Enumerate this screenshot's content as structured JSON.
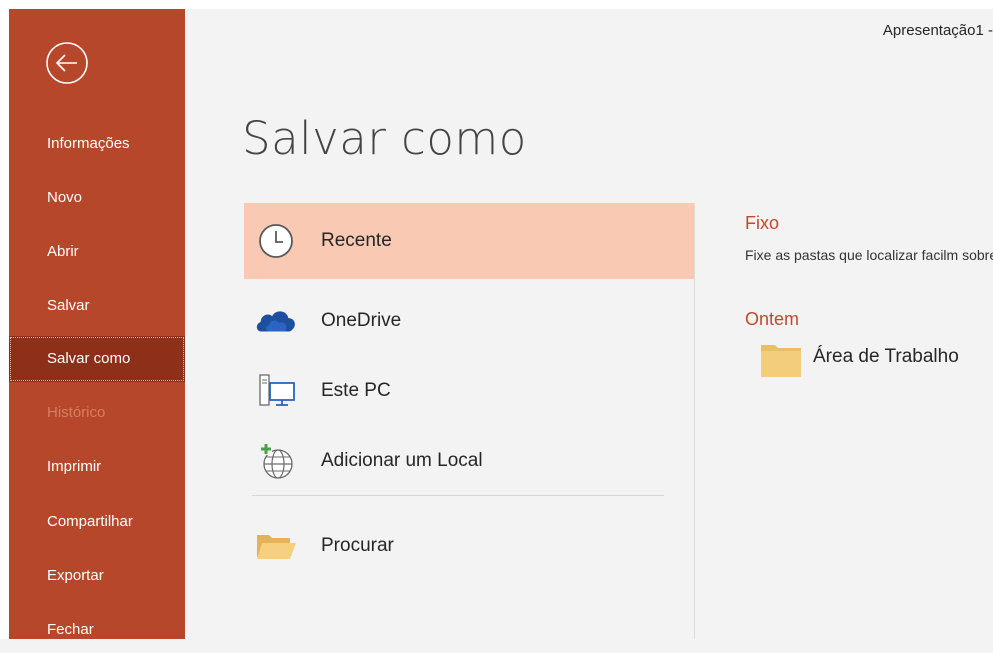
{
  "window": {
    "document_title": "Apresentação1 -"
  },
  "sidebar": {
    "back_icon": "arrow-left-circle-icon",
    "items": [
      {
        "label": "Informações",
        "state": "normal"
      },
      {
        "label": "Novo",
        "state": "normal"
      },
      {
        "label": "Abrir",
        "state": "normal"
      },
      {
        "label": "Salvar",
        "state": "normal"
      },
      {
        "label": "Salvar como",
        "state": "active"
      },
      {
        "label": "Histórico",
        "state": "disabled"
      },
      {
        "label": "Imprimir",
        "state": "normal"
      },
      {
        "label": "Compartilhar",
        "state": "normal"
      },
      {
        "label": "Exportar",
        "state": "normal"
      },
      {
        "label": "Fechar",
        "state": "normal"
      }
    ]
  },
  "main": {
    "title": "Salvar como",
    "locations": [
      {
        "label": "Recente",
        "icon": "clock-icon",
        "selected": true
      },
      {
        "label": "OneDrive",
        "icon": "onedrive-cloud-icon",
        "selected": false
      },
      {
        "label": "Este PC",
        "icon": "computer-icon",
        "selected": false
      },
      {
        "label": "Adicionar um Local",
        "icon": "add-globe-icon",
        "selected": false
      },
      {
        "label": "Procurar",
        "icon": "open-folder-icon",
        "selected": false
      }
    ]
  },
  "right_panel": {
    "pinned_heading": "Fixo",
    "pinned_description": "Fixe as pastas que localizar facilm sobre uma pasta.",
    "yesterday_heading": "Ontem",
    "yesterday_item": {
      "label": "Área de Trabalho",
      "icon": "folder-icon"
    }
  },
  "colors": {
    "sidebar": "#b7472a",
    "sidebar_active": "#8e2f19",
    "selected_location": "#f9c9b4",
    "accent_text": "#c2492a"
  }
}
